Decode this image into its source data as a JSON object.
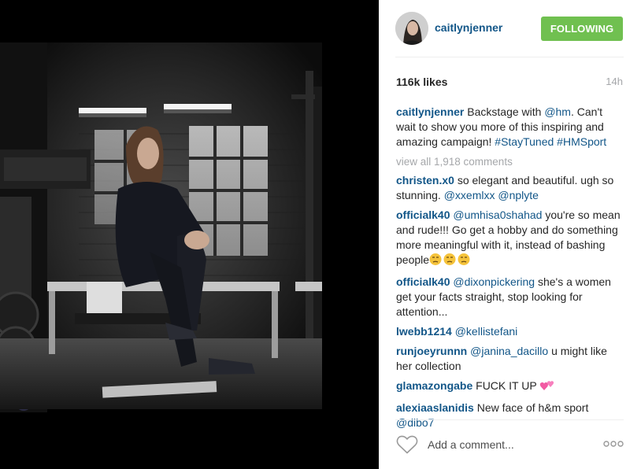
{
  "post": {
    "username": "caitlynjenner",
    "follow_label": "FOLLOWING",
    "likes": "116k likes",
    "time_ago": "14h"
  },
  "caption": {
    "user": "caitlynjenner",
    "t1": " Backstage with ",
    "mention": "@hm",
    "t2": ". Can't wait to show you more of this inspiring and amazing campaign! ",
    "tag1": "#StayTuned",
    "t3": " ",
    "tag2": "#HMSport"
  },
  "view_all": "view all 1,918 comments",
  "comments": [
    {
      "user": "christen.x0",
      "text": " so elegant and beautiful. ugh so stunning. ",
      "mention": "@xxemlxx",
      "mention2": "@nplyte",
      "sep": " "
    },
    {
      "user": "officialk40",
      "mention": "@umhisa0shahad",
      "text": " you're so mean and rude!!! Go get a hobby and do something more meaningful with it, instead of bashing people"
    },
    {
      "user": "officialk40",
      "mention": "@dixonpickering",
      "text": " she's a women get your facts straight, stop looking for attention..."
    },
    {
      "user": "lwebb1214",
      "mention": "@kellistefani"
    },
    {
      "user": "runjoeyrunnn",
      "mention": "@janina_dacillo",
      "text": " u might like her collection"
    },
    {
      "user": "glamazongabe",
      "text": " FUCK IT UP "
    },
    {
      "user": "alexiaaslanidis",
      "text": " New face of h&m sport ",
      "mention": "@dibo7"
    }
  ],
  "footer": {
    "comment_placeholder": "Add a comment...",
    "more_label": "ooo"
  },
  "icons": {
    "avatar": "avatar",
    "like": "heart-icon",
    "more": "more-options-icon",
    "emoji_unamused": "unamused-face-emoji",
    "emoji_hearts": "two-hearts-emoji"
  },
  "colors": {
    "link": "#125688",
    "follow_button": "#70c050",
    "muted": "#a5a7aa"
  }
}
